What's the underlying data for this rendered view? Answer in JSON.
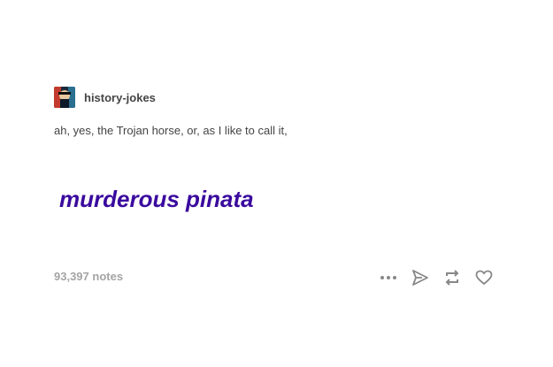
{
  "post": {
    "blog_name": "history-jokes",
    "avatar_icon": "blog-avatar-icon",
    "body_text": "ah, yes, the Trojan horse, or, as I like to call it,",
    "big_text": "murderous pinata",
    "big_text_color": "#3a0a9e",
    "notes": "93,397 notes"
  },
  "actions": [
    {
      "name": "more-icon"
    },
    {
      "name": "share-icon"
    },
    {
      "name": "reblog-icon"
    },
    {
      "name": "like-icon"
    }
  ],
  "colors": {
    "text": "#444444",
    "muted": "#a4a4a4",
    "icon": "#888888"
  }
}
